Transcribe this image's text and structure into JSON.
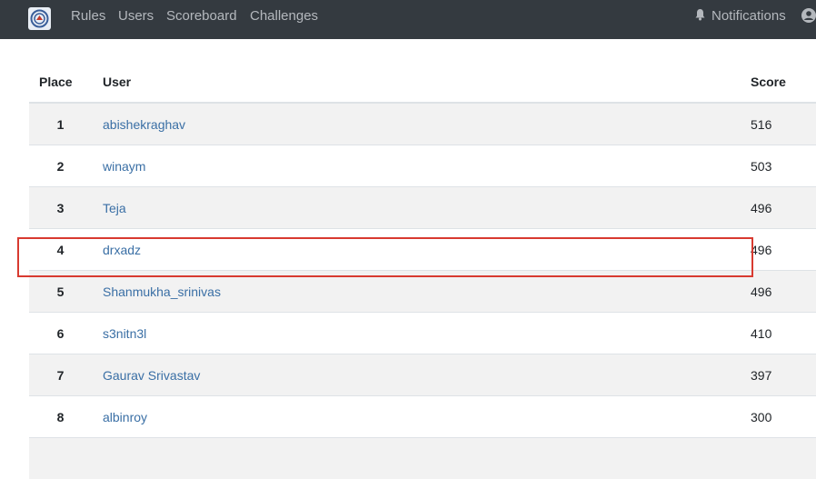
{
  "nav": {
    "links": [
      "Rules",
      "Users",
      "Scoreboard",
      "Challenges"
    ],
    "notifications_label": "Notifications",
    "background": "#343a40",
    "text_color": "#b4b8bd"
  },
  "table": {
    "headers": {
      "place": "Place",
      "user": "User",
      "score": "Score"
    },
    "rows": [
      {
        "place": "1",
        "user": "abishekraghav",
        "score": "516"
      },
      {
        "place": "2",
        "user": "winaym",
        "score": "503"
      },
      {
        "place": "3",
        "user": "Teja",
        "score": "496"
      },
      {
        "place": "4",
        "user": "drxadz",
        "score": "496"
      },
      {
        "place": "5",
        "user": "Shanmukha_srinivas",
        "score": "496"
      },
      {
        "place": "6",
        "user": "s3nitn3l",
        "score": "410"
      },
      {
        "place": "7",
        "user": "Gaurav Srivastav",
        "score": "397"
      },
      {
        "place": "8",
        "user": "albinroy",
        "score": "300"
      }
    ],
    "link_color": "#3a6fa5",
    "stripe_color": "#f2f2f2"
  },
  "highlight": {
    "row_place": "4",
    "color": "#d83a30"
  }
}
